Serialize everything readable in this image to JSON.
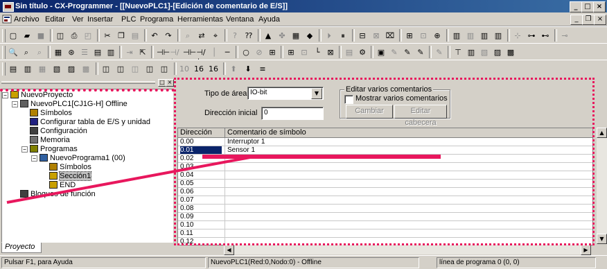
{
  "window": {
    "title": "Sin título - CX-Programmer - [[NuevoPLC1]-[Edición de comentario de E/S]]",
    "controls": {
      "minimize": "_",
      "maximize": "□",
      "close": "×"
    },
    "mdi_controls": {
      "minimize": "_",
      "restore": "❐",
      "close": "×"
    }
  },
  "menu": {
    "items": [
      "Archivo",
      "Editar",
      "Ver",
      "Insertar",
      "PLC",
      "Programa",
      "Herramientas",
      "Ventana",
      "Ayuda"
    ]
  },
  "toolbars": {
    "row1": [
      {
        "icon": "new-file-icon",
        "glyph": "▢"
      },
      {
        "icon": "open-folder-icon",
        "glyph": "▰"
      },
      {
        "icon": "save-icon",
        "glyph": "■"
      },
      {
        "icon": "properties-icon",
        "glyph": "◫"
      },
      {
        "icon": "print-icon",
        "glyph": "⎙"
      },
      {
        "icon": "print-preview-icon",
        "glyph": "◰"
      },
      {
        "icon": "cut-icon",
        "glyph": "✂"
      },
      {
        "icon": "copy-icon",
        "glyph": "❐"
      },
      {
        "icon": "paste-icon",
        "glyph": "▤"
      },
      {
        "icon": "undo-icon",
        "glyph": "↶"
      },
      {
        "icon": "redo-icon",
        "glyph": "↷"
      },
      {
        "icon": "find-icon",
        "glyph": "⌕"
      },
      {
        "icon": "replace-icon",
        "glyph": "⇄"
      },
      {
        "icon": "cross-reference-icon",
        "glyph": "⌖"
      },
      {
        "icon": "help-icon",
        "glyph": "?"
      },
      {
        "icon": "context-help-icon",
        "glyph": "⁇"
      },
      {
        "icon": "online-icon",
        "glyph": "▲"
      },
      {
        "icon": "online-alt-icon",
        "glyph": "✤"
      },
      {
        "icon": "transfer-icon",
        "glyph": "▦"
      },
      {
        "icon": "monitor-icon",
        "glyph": "◆"
      },
      {
        "icon": "run-mode-icon",
        "glyph": "⏵"
      },
      {
        "icon": "stop-mode-icon",
        "glyph": "⏸"
      },
      {
        "icon": "compare-icon",
        "glyph": "⊟"
      },
      {
        "icon": "diff-icon",
        "glyph": "⊠"
      },
      {
        "icon": "check-icon",
        "glyph": "⌧"
      },
      {
        "icon": "set-icon",
        "glyph": "⊞"
      },
      {
        "icon": "reset-icon",
        "glyph": "⊡"
      },
      {
        "icon": "force-icon",
        "glyph": "⊕"
      },
      {
        "icon": "window-a-icon",
        "glyph": "▥"
      },
      {
        "icon": "window-b-icon",
        "glyph": "▥"
      },
      {
        "icon": "window-c-icon",
        "glyph": "▥"
      },
      {
        "icon": "window-d-icon",
        "glyph": "▥"
      },
      {
        "icon": "zoom-in-icon",
        "glyph": "⊹"
      },
      {
        "icon": "zoom-out-icon",
        "glyph": "⊶"
      },
      {
        "icon": "grid-icon",
        "glyph": "⊷"
      },
      {
        "icon": "tile-icon",
        "glyph": "⊸"
      }
    ],
    "row2": [
      {
        "icon": "zoom-tool-icon",
        "glyph": "🔍"
      },
      {
        "icon": "zoom-out-tool-icon",
        "glyph": "⌕"
      },
      {
        "icon": "find-tool-icon",
        "glyph": "⌕"
      },
      {
        "icon": "grid-view-icon",
        "glyph": "▦"
      },
      {
        "icon": "symbol-icon",
        "glyph": "⊛"
      },
      {
        "icon": "list-view-icon",
        "glyph": "☰"
      },
      {
        "icon": "io-table-icon",
        "glyph": "▤"
      },
      {
        "icon": "comment-view-icon",
        "glyph": "▥"
      },
      {
        "icon": "rung-icon",
        "glyph": "⇥"
      },
      {
        "icon": "select-icon",
        "glyph": "⇱"
      },
      {
        "icon": "contact-no-icon",
        "glyph": "⊣⊢"
      },
      {
        "icon": "contact-nc-icon",
        "glyph": "⊣/⊢"
      },
      {
        "icon": "contact-or-icon",
        "glyph": "⊣⊢"
      },
      {
        "icon": "contact-ornc-icon",
        "glyph": "⊣/⊢"
      },
      {
        "icon": "vertical-line-icon",
        "glyph": "│"
      },
      {
        "icon": "horizontal-line-icon",
        "glyph": "─"
      },
      {
        "icon": "coil-icon",
        "glyph": "○"
      },
      {
        "icon": "coil-nc-icon",
        "glyph": "⊘"
      },
      {
        "icon": "instruction-icon",
        "glyph": "⊞"
      },
      {
        "icon": "instruction-b-icon",
        "glyph": "⊞"
      },
      {
        "icon": "instruction-c-icon",
        "glyph": "⊡"
      },
      {
        "icon": "line-draw-icon",
        "glyph": "└"
      },
      {
        "icon": "line-delete-icon",
        "glyph": "⊠"
      },
      {
        "icon": "mnemonic-icon",
        "glyph": "▤"
      },
      {
        "icon": "settings-icon",
        "glyph": "⚙"
      },
      {
        "icon": "memory-icon",
        "glyph": "▣"
      },
      {
        "icon": "online-edit-icon",
        "glyph": "✎"
      },
      {
        "icon": "online-edit-b-icon",
        "glyph": "✎"
      },
      {
        "icon": "online-edit-c-icon",
        "glyph": "✎"
      },
      {
        "icon": "online-edit-d-icon",
        "glyph": "✎"
      },
      {
        "icon": "tag-icon",
        "glyph": "⊤"
      },
      {
        "icon": "data-trace-icon",
        "glyph": "▥"
      },
      {
        "icon": "time-chart-icon",
        "glyph": "▧"
      },
      {
        "icon": "chart-b-icon",
        "glyph": "▨"
      },
      {
        "icon": "chart-c-icon",
        "glyph": "▩"
      }
    ],
    "row3": [
      {
        "icon": "project-window-icon",
        "glyph": "▤"
      },
      {
        "icon": "output-window-icon",
        "glyph": "▥"
      },
      {
        "icon": "watch-window-icon",
        "glyph": "▦"
      },
      {
        "icon": "address-ref-icon",
        "glyph": "▧"
      },
      {
        "icon": "ladder-window-icon",
        "glyph": "▨"
      },
      {
        "icon": "properties-window-icon",
        "glyph": "▩"
      },
      {
        "icon": "toggle-a-icon",
        "glyph": "◫"
      },
      {
        "icon": "toggle-b-icon",
        "glyph": "◫"
      },
      {
        "icon": "toggle-c-icon",
        "glyph": "◫"
      },
      {
        "icon": "toggle-d-icon",
        "glyph": "◫"
      },
      {
        "icon": "toggle-e-icon",
        "glyph": "◫"
      },
      {
        "icon": "digits-10-icon",
        "glyph": "10"
      },
      {
        "icon": "digits-16-icon",
        "glyph": "16"
      },
      {
        "icon": "hex-16-icon",
        "glyph": "16"
      },
      {
        "icon": "arrow-up-icon",
        "glyph": "⬆"
      },
      {
        "icon": "arrow-down-icon",
        "glyph": "⬇"
      },
      {
        "icon": "stack-icon",
        "glyph": "≡"
      }
    ]
  },
  "project_tree": {
    "nodes": [
      {
        "label": "NuevoProyecto",
        "icon": "project-icon",
        "depth": 0,
        "expander": "−"
      },
      {
        "label": "NuevoPLC1[CJ1G-H] Offline",
        "icon": "plc-icon",
        "depth": 1,
        "expander": "−"
      },
      {
        "label": "Símbolos",
        "icon": "symbols-icon",
        "depth": 2,
        "expander": ""
      },
      {
        "label": "Configurar tabla de E/S y unidad",
        "icon": "io-table-icon",
        "depth": 2,
        "expander": ""
      },
      {
        "label": "Configuración",
        "icon": "settings-icon",
        "depth": 2,
        "expander": ""
      },
      {
        "label": "Memoria",
        "icon": "memory-icon",
        "depth": 2,
        "expander": ""
      },
      {
        "label": "Programas",
        "icon": "programs-icon",
        "depth": 2,
        "expander": "−"
      },
      {
        "label": "NuevoPrograma1 (00)",
        "icon": "program-icon",
        "depth": 3,
        "expander": "−"
      },
      {
        "label": "Símbolos",
        "icon": "symbols-icon",
        "depth": 4,
        "expander": ""
      },
      {
        "label": "Sección1",
        "icon": "section-icon",
        "depth": 4,
        "expander": "",
        "selected": true
      },
      {
        "label": "END",
        "icon": "section-icon",
        "depth": 4,
        "expander": ""
      },
      {
        "label": "Bloques de función",
        "icon": "function-blocks-icon",
        "depth": 1,
        "expander": ""
      }
    ],
    "tab_label": "Proyecto",
    "pane_close": "×",
    "pane_restore": "□"
  },
  "io_comment_editor": {
    "area_type_label": "Tipo de área",
    "area_type_value": "IO-bit",
    "start_address_label": "Dirección inicial",
    "start_address_value": "0",
    "multi_edit_group_title": "Editar varios comentarios",
    "show_multiple_label": "Mostrar varios comentarios",
    "change_button": "Cambiar",
    "edit_header_button": "Editar cabecera",
    "columns": {
      "address": "Dirección",
      "comment": "Comentario de símbolo"
    },
    "rows": [
      {
        "address": "0.00",
        "comment": "Interruptor 1"
      },
      {
        "address": "0.01",
        "comment": "Sensor 1",
        "selected": true
      },
      {
        "address": "0.02",
        "comment": ""
      },
      {
        "address": "0.03",
        "comment": ""
      },
      {
        "address": "0.04",
        "comment": ""
      },
      {
        "address": "0.05",
        "comment": ""
      },
      {
        "address": "0.06",
        "comment": ""
      },
      {
        "address": "0.07",
        "comment": ""
      },
      {
        "address": "0.08",
        "comment": ""
      },
      {
        "address": "0.09",
        "comment": ""
      },
      {
        "address": "0.10",
        "comment": ""
      },
      {
        "address": "0.11",
        "comment": ""
      },
      {
        "address": "0.12",
        "comment": ""
      }
    ]
  },
  "statusbar": {
    "help": "Pulsar F1, para Ayuda",
    "connection": "NuevoPLC1(Red:0,Nodo:0) - Offline",
    "program_line": "línea de programa 0 (0, 0)"
  },
  "colors": {
    "titlebar": "#0a246a",
    "annotation": "#e8175d",
    "face": "#d4d0c8"
  }
}
